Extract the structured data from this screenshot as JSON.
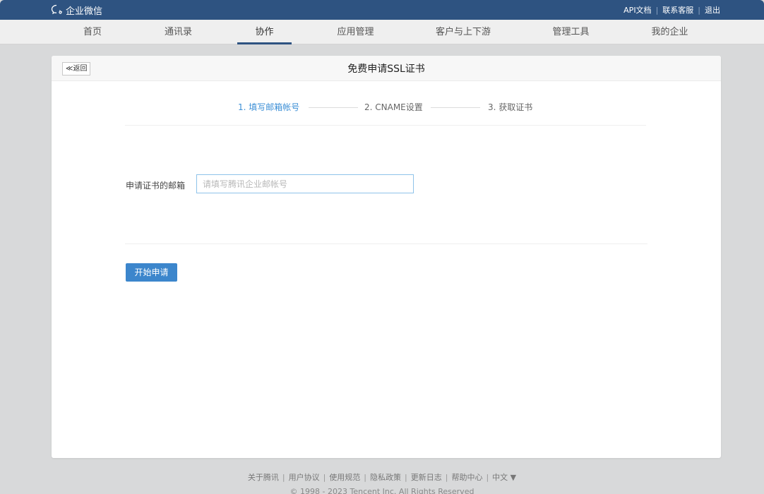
{
  "brand": {
    "name": "企业微信"
  },
  "top_links": [
    "API文档",
    "联系客服",
    "退出"
  ],
  "nav": {
    "items": [
      "首页",
      "通讯录",
      "协作",
      "应用管理",
      "客户与上下游",
      "管理工具",
      "我的企业"
    ],
    "active": "协作"
  },
  "panel": {
    "back_label": "≪返回",
    "title": "免费申请SSL证书"
  },
  "steps": [
    "1. 填写邮箱帐号",
    "2. CNAME设置",
    "3. 获取证书"
  ],
  "active_step": 1,
  "form": {
    "email_label": "申请证书的邮箱",
    "email_value": "",
    "email_placeholder": "请填写腾讯企业邮帐号",
    "submit_label": "开始申请"
  },
  "footer": {
    "links": [
      "关于腾讯",
      "用户协议",
      "使用规范",
      "隐私政策",
      "更新日志",
      "帮助中心",
      "中文 ▼"
    ],
    "copyright": "© 1998 - 2023 Tencent Inc. All Rights Reserved"
  },
  "colors": {
    "header_bg": "#2e5381",
    "accent": "#3c86cc",
    "active_step": "#3c8fd6"
  }
}
